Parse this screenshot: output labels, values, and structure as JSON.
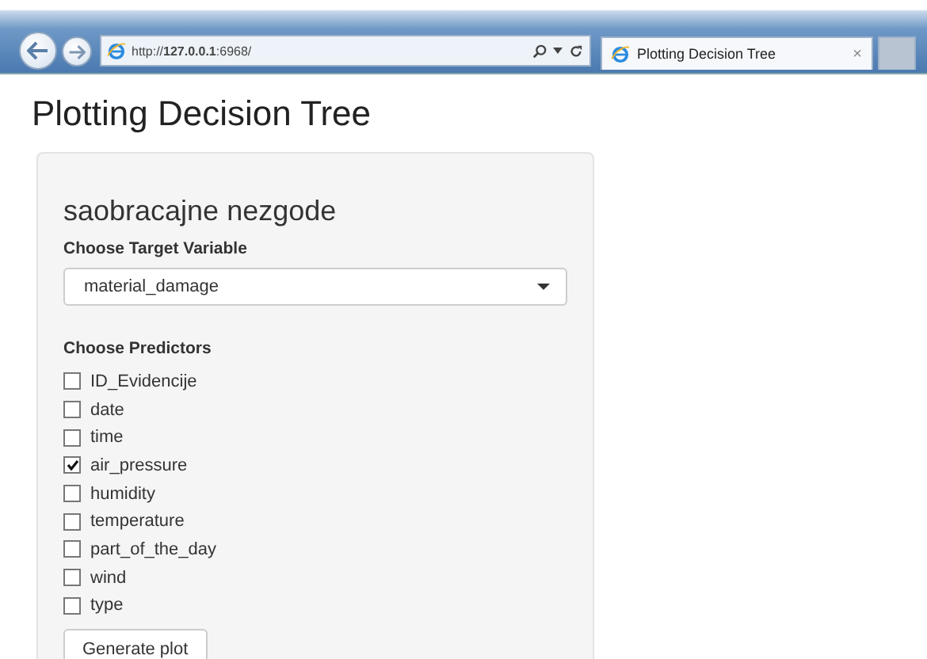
{
  "browser": {
    "url": "http://**127.0.0.1**:6968/",
    "tab": {
      "title": "Plotting Decision Tree",
      "close": "×",
      "selected": true
    }
  },
  "page": {
    "title": "Plotting Decision Tree"
  },
  "panel": {
    "heading": "saobracajne nezgode",
    "target": {
      "label": "Choose Target Variable",
      "value": "material_damage"
    },
    "predictors": {
      "label": "Choose Predictors",
      "items": [
        {
          "label": "ID_Evidencije",
          "checked": false
        },
        {
          "label": "date",
          "checked": false
        },
        {
          "label": "time",
          "checked": false
        },
        {
          "label": "air_pressure",
          "checked": true
        },
        {
          "label": "humidity",
          "checked": false
        },
        {
          "label": "temperature",
          "checked": false
        },
        {
          "label": "part_of_the_day",
          "checked": false
        },
        {
          "label": "wind",
          "checked": false
        },
        {
          "label": "type",
          "checked": false
        }
      ]
    },
    "button": "Generate plot"
  }
}
